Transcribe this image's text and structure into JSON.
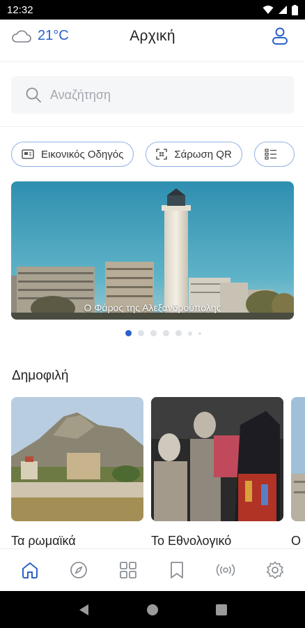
{
  "status_bar": {
    "time": "12:32"
  },
  "header": {
    "temperature": "21°C",
    "title": "Αρχική",
    "weather_icon": "cloud-icon",
    "profile_icon": "user-icon"
  },
  "search": {
    "placeholder": "Αναζήτηση"
  },
  "chips": [
    {
      "label": "Εικονικός Οδηγός",
      "icon": "guide-icon"
    },
    {
      "label": "Σάρωση QR",
      "icon": "qr-scan-icon"
    },
    {
      "label": "",
      "icon": "list-icon"
    }
  ],
  "hero": {
    "caption": "Ο Φάρος της Αλεξανδρούπολης",
    "slide_count": 7,
    "active_slide": 1
  },
  "popular": {
    "title": "Δημοφιλή",
    "items": [
      {
        "name": "Τα ρωμαϊκά"
      },
      {
        "name": "Το Εθνολογικό"
      },
      {
        "name": "Ο"
      }
    ]
  },
  "bottom_nav": [
    {
      "icon": "home-icon",
      "active": true
    },
    {
      "icon": "compass-icon",
      "active": false
    },
    {
      "icon": "grid-icon",
      "active": false
    },
    {
      "icon": "bookmark-icon",
      "active": false
    },
    {
      "icon": "beacon-icon",
      "active": false
    },
    {
      "icon": "settings-icon",
      "active": false
    }
  ],
  "colors": {
    "accent": "#2a62c9",
    "chip_border": "#8fb0e6",
    "search_bg": "#f5f6f8"
  }
}
